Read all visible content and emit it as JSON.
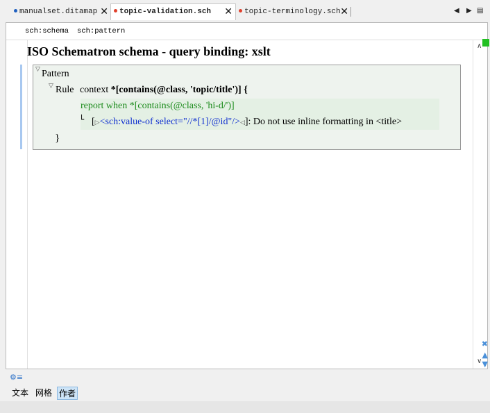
{
  "tabs": [
    {
      "label": "manualset.ditamap",
      "dot_color": "#2060c0",
      "active": false
    },
    {
      "label": "topic-validation.sch",
      "dot_color": "#e0402c",
      "active": true
    },
    {
      "label": "topic-terminology.sch",
      "dot_color": "#e0402c",
      "active": false
    }
  ],
  "tab_close_glyph": "✕",
  "nav": {
    "prev": "◀",
    "next": "▶",
    "list": "▤"
  },
  "breadcrumb": [
    "sch:schema",
    "sch:pattern"
  ],
  "editor": {
    "title": "ISO Schematron schema - query binding: xslt",
    "pattern": {
      "label": "Pattern",
      "rule_label": "Rule",
      "rule_context_prefix": "context",
      "rule_context_expr": "*[contains(@class, 'topic/title')] {",
      "report_line": "report when *[contains(@class, 'hi-d/')]",
      "message_prefix": "[",
      "message_element": "<sch:value-of select=\"//*[1]/@id\"/>",
      "message_suffix": "]: Do not use inline formatting in <title>",
      "closing_brace": "}"
    }
  },
  "bottom": {
    "gear": "⚙≡",
    "mode_tabs": [
      "文本",
      "网格",
      "作者"
    ],
    "active_mode": "作者"
  }
}
